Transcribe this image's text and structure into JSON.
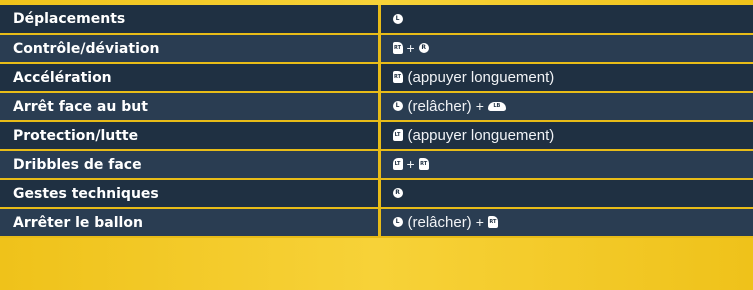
{
  "rows": [
    {
      "action": "Déplacements",
      "tokens": [
        {
          "kind": "button",
          "icon": "ls-stick-icon",
          "shape": "stick",
          "glyph": "L"
        }
      ]
    },
    {
      "action": "Contrôle/déviation",
      "tokens": [
        {
          "kind": "button",
          "icon": "rt-trigger-icon",
          "shape": "bumper-r",
          "glyph": "RT"
        },
        {
          "kind": "sep",
          "text": "+"
        },
        {
          "kind": "button",
          "icon": "rs-stick-icon",
          "shape": "stick",
          "glyph": "R"
        }
      ]
    },
    {
      "action": "Accélération",
      "tokens": [
        {
          "kind": "button",
          "icon": "rt-trigger-icon",
          "shape": "bumper-r",
          "glyph": "RT"
        },
        {
          "kind": "text",
          "text": "(appuyer longuement)"
        }
      ]
    },
    {
      "action": "Arrêt face au but",
      "tokens": [
        {
          "kind": "button",
          "icon": "ls-stick-icon",
          "shape": "stick",
          "glyph": "L"
        },
        {
          "kind": "text",
          "text": "(relâcher)"
        },
        {
          "kind": "sep",
          "text": "+"
        },
        {
          "kind": "button",
          "icon": "lb-bumper-icon",
          "shape": "shoulder",
          "glyph": "LB"
        }
      ]
    },
    {
      "action": "Protection/lutte",
      "tokens": [
        {
          "kind": "button",
          "icon": "lt-trigger-icon",
          "shape": "bumper-l",
          "glyph": "LT"
        },
        {
          "kind": "text",
          "text": "(appuyer longuement)"
        }
      ]
    },
    {
      "action": "Dribbles de face",
      "tokens": [
        {
          "kind": "button",
          "icon": "lt-trigger-icon",
          "shape": "bumper-l",
          "glyph": "LT"
        },
        {
          "kind": "sep",
          "text": "+"
        },
        {
          "kind": "button",
          "icon": "rt-trigger-icon",
          "shape": "bumper-r",
          "glyph": "RT"
        }
      ]
    },
    {
      "action": "Gestes techniques",
      "tokens": [
        {
          "kind": "button",
          "icon": "rs-stick-icon",
          "shape": "stick",
          "glyph": "R"
        }
      ]
    },
    {
      "action": "Arrêter le ballon",
      "tokens": [
        {
          "kind": "button",
          "icon": "ls-stick-icon",
          "shape": "stick",
          "glyph": "L"
        },
        {
          "kind": "text",
          "text": "(relâcher)"
        },
        {
          "kind": "sep",
          "text": "+"
        },
        {
          "kind": "button",
          "icon": "rt-trigger-icon",
          "shape": "bumper-r",
          "glyph": "RT"
        }
      ]
    }
  ]
}
